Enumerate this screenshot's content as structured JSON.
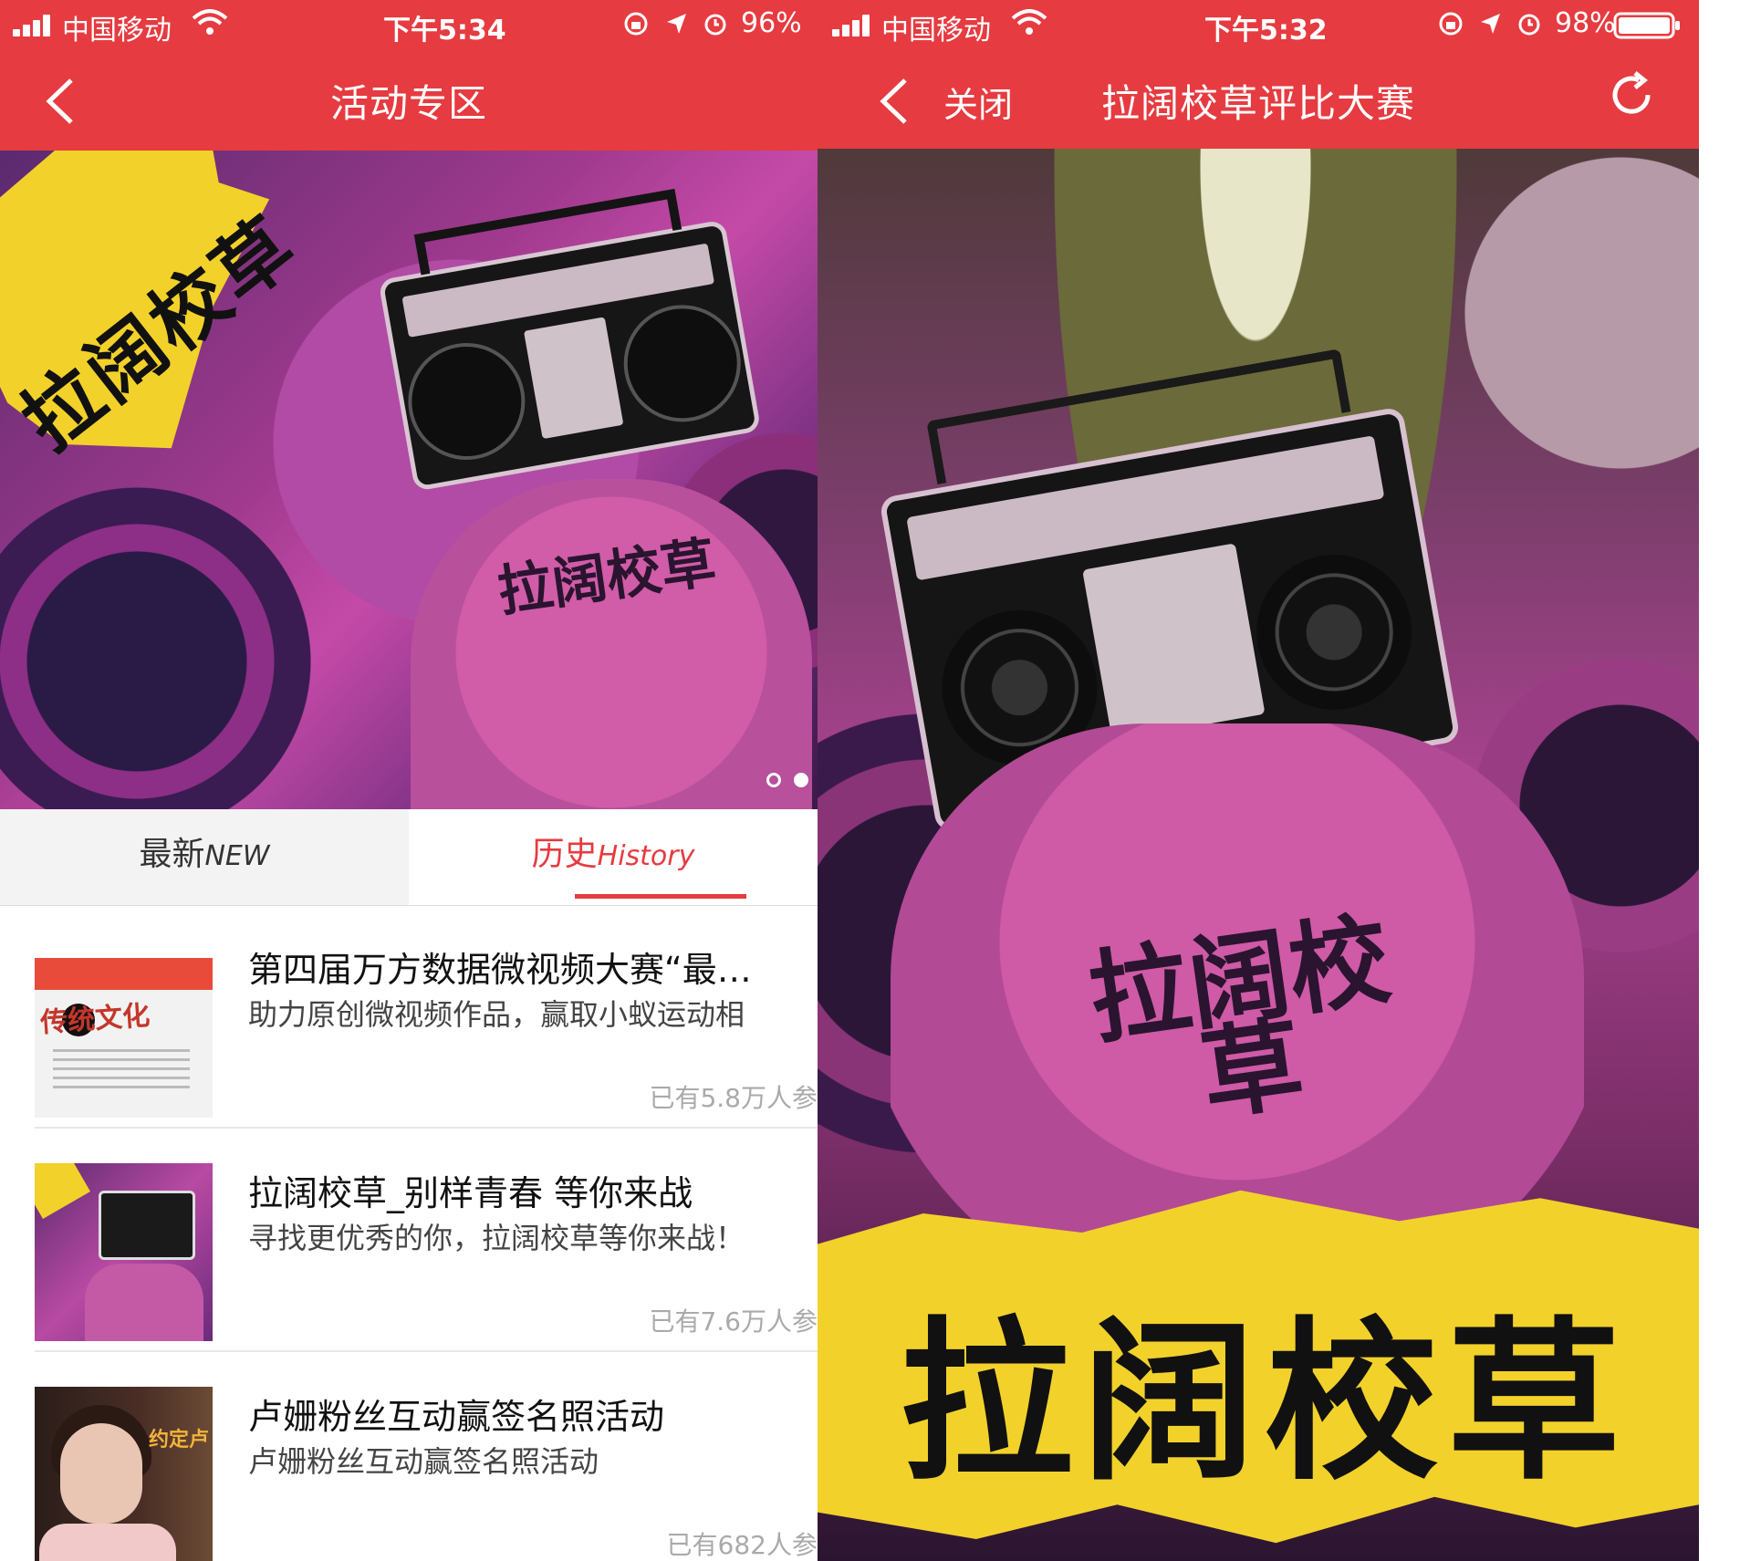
{
  "left": {
    "status": {
      "carrier": "中国移动",
      "time": "下午5:34",
      "battery": "96%"
    },
    "nav": {
      "title": "活动专区"
    },
    "banner": {
      "title": "拉阔校草"
    },
    "tabs": [
      {
        "label_cn": "最新",
        "label_en": "NEW"
      },
      {
        "label_cn": "历史",
        "label_en": "History"
      }
    ],
    "list": [
      {
        "title": "第四届万方数据微视频大赛“最…",
        "desc": "助力原创微视频作品，赢取小蚁运动相",
        "count": "已有5.8万人参",
        "thumb_text": "传统文化"
      },
      {
        "title": "拉阔校草_别样青春 等你来战",
        "desc": "寻找更优秀的你，拉阔校草等你来战！",
        "count": "已有7.6万人参"
      },
      {
        "title": "卢姗粉丝互动赢签名照活动",
        "desc": "卢姗粉丝互动赢签名照活动",
        "count": "已有682人参",
        "thumb_text": "约定卢"
      }
    ]
  },
  "right": {
    "status": {
      "carrier": "中国移动",
      "time": "下午5:32",
      "battery": "98%"
    },
    "nav": {
      "close": "关闭",
      "title": "拉阔校草评比大赛"
    },
    "poster": {
      "title": "拉阔校草"
    }
  },
  "colors": {
    "brand_red": "#e63b40",
    "tab_active": "#e63b40",
    "splash_yellow": "#f2d12b"
  }
}
